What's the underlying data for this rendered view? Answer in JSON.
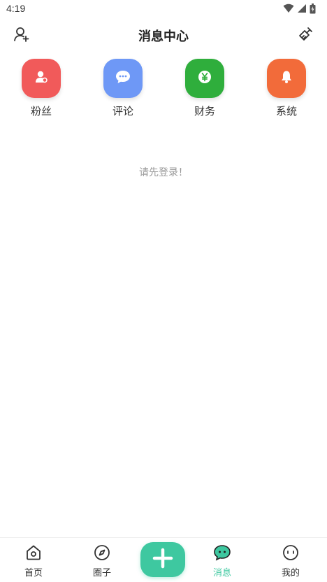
{
  "status_bar": {
    "time": "4:19"
  },
  "header": {
    "title": "消息中心"
  },
  "categories": [
    {
      "label": "粉丝",
      "icon": "person-icon",
      "color": "#f15a5a"
    },
    {
      "label": "评论",
      "icon": "chat-bubble-icon",
      "color": "#6e98f6"
    },
    {
      "label": "财务",
      "icon": "yen-coin-icon",
      "color": "#2fae3c"
    },
    {
      "label": "系统",
      "icon": "bell-icon",
      "color": "#f26b3a"
    }
  ],
  "empty_message": "请先登录！",
  "bottom_nav": {
    "items": [
      {
        "label": "首页",
        "icon": "home-icon"
      },
      {
        "label": "圈子",
        "icon": "compass-icon"
      },
      {
        "label": "消息",
        "icon": "message-icon"
      },
      {
        "label": "我的",
        "icon": "profile-face-icon"
      }
    ],
    "active": "消息",
    "accent": "#3ec8a0"
  }
}
